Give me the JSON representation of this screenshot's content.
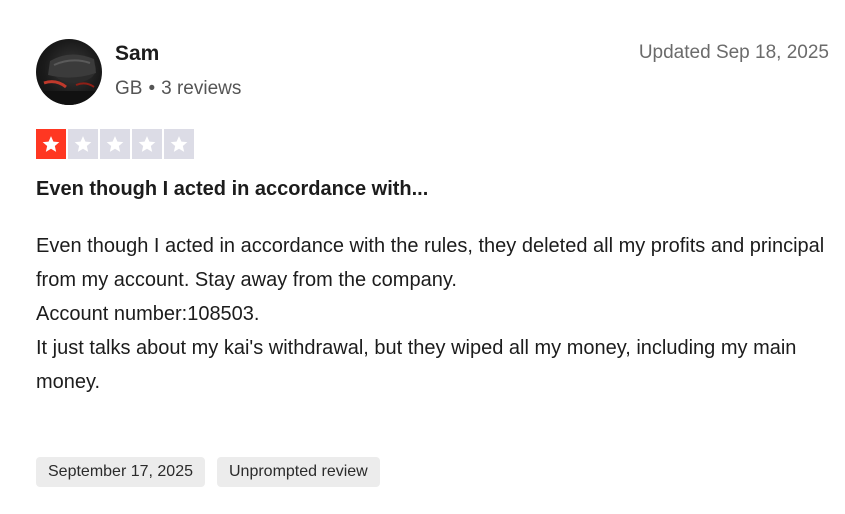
{
  "review": {
    "author": {
      "name": "Sam",
      "country": "GB",
      "review_count": "3 reviews",
      "avatar_icon": "user-avatar-photo"
    },
    "updated": "Updated Sep 18, 2025",
    "rating": {
      "value": 1,
      "max": 5,
      "filled_color": "#ff3722",
      "empty_color": "#dcdce6"
    },
    "title": "Even though I acted in accordance with...",
    "body_lines": [
      "Even though I acted in accordance with the rules, they deleted all my profits and principal from my account. Stay away from the company.",
      "Account number:108503.",
      "It just talks about my kai's withdrawal, but they wiped all my money, including my main money."
    ],
    "tags": {
      "date": "September 17, 2025",
      "type": "Unprompted review"
    }
  }
}
